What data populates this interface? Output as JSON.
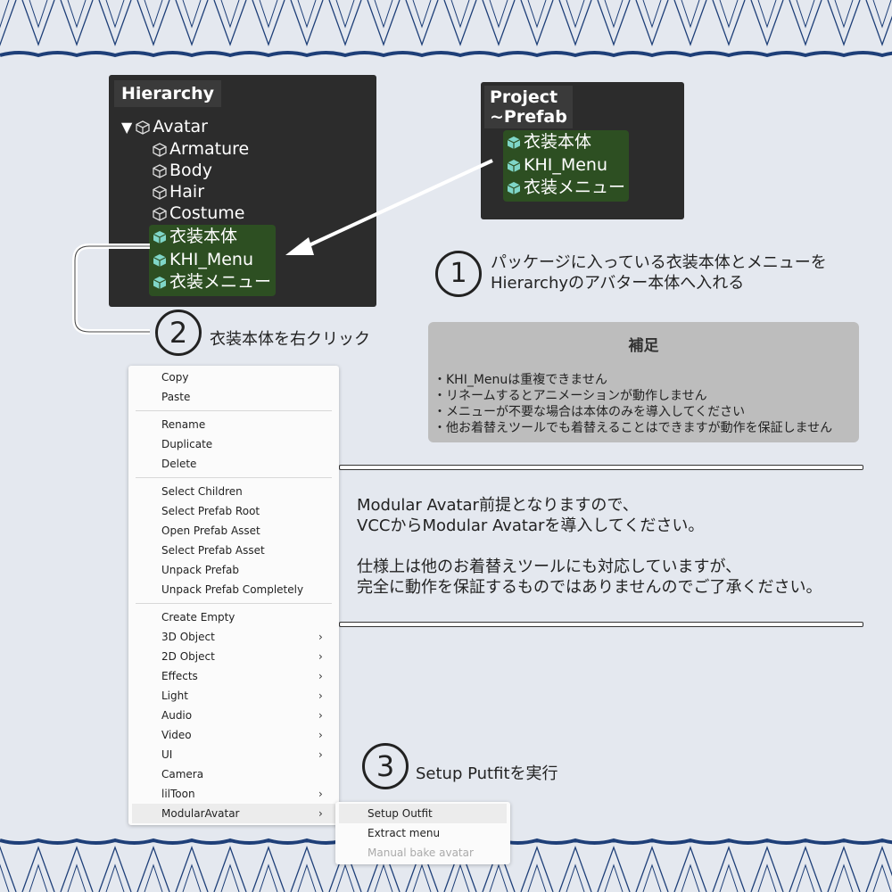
{
  "colors": {
    "background": "#e4e8ef",
    "border_wave": "#1e3f78",
    "panel_bg": "#2c2c2c",
    "green_highlight": "#2d4f22",
    "prefab_icon": "#7fd6c8",
    "note_bg": "#bdbdbd"
  },
  "hierarchy": {
    "title": "Hierarchy",
    "root": "Avatar",
    "children": [
      "Armature",
      "Body",
      "Hair",
      "Costume"
    ],
    "prefabs": [
      "衣装本体",
      "KHI_Menu",
      "衣装メニュー"
    ]
  },
  "project": {
    "title_line1": "Project",
    "title_line2": "~Prefab",
    "prefabs": [
      "衣装本体",
      "KHI_Menu",
      "衣装メニュー"
    ]
  },
  "steps": {
    "step1_num": "①",
    "step1_line1": "パッケージに入っている衣装本体とメニューを",
    "step1_line2": "Hierarchyのアバター本体へ入れる",
    "step2_num": "②",
    "step2_text": "衣装本体を右クリック",
    "step3_num": "③",
    "step3_text": "Setup Putfitを実行"
  },
  "note": {
    "title": "補足",
    "lines": [
      "・KHI_Menuは重複できません",
      "・リネームするとアニメーションが動作しません",
      "・メニューが不要な場合は本体のみを導入してください",
      "・他お着替えツールでも着替えることはできますが動作を保証しません"
    ]
  },
  "main_text": {
    "line1": "Modular Avatar前提となりますので、",
    "line2": "VCCからModular Avatarを導入してください。",
    "line3": "仕様上は他のお着替えツールにも対応していますが、",
    "line4": "完全に動作を保証するものではありませんのでご了承ください。"
  },
  "context_menu": {
    "group1": [
      "Copy",
      "Paste"
    ],
    "group2": [
      "Rename",
      "Duplicate",
      "Delete"
    ],
    "group3": [
      "Select Children",
      "Select Prefab Root",
      "Open Prefab Asset",
      "Select Prefab Asset",
      "Unpack Prefab",
      "Unpack Prefab Completely"
    ],
    "group4": [
      {
        "label": "Create Empty",
        "submenu": false
      },
      {
        "label": "3D Object",
        "submenu": true
      },
      {
        "label": "2D Object",
        "submenu": true
      },
      {
        "label": "Effects",
        "submenu": true
      },
      {
        "label": "Light",
        "submenu": true
      },
      {
        "label": "Audio",
        "submenu": true
      },
      {
        "label": "Video",
        "submenu": true
      },
      {
        "label": "UI",
        "submenu": true
      },
      {
        "label": "Camera",
        "submenu": false
      },
      {
        "label": "lilToon",
        "submenu": true
      },
      {
        "label": "ModularAvatar",
        "submenu": true
      }
    ],
    "chevron": "›"
  },
  "submenu": {
    "items": [
      {
        "label": "Setup Outfit",
        "enabled": true
      },
      {
        "label": "Extract menu",
        "enabled": true
      },
      {
        "label": "Manual bake avatar",
        "enabled": false
      }
    ]
  }
}
